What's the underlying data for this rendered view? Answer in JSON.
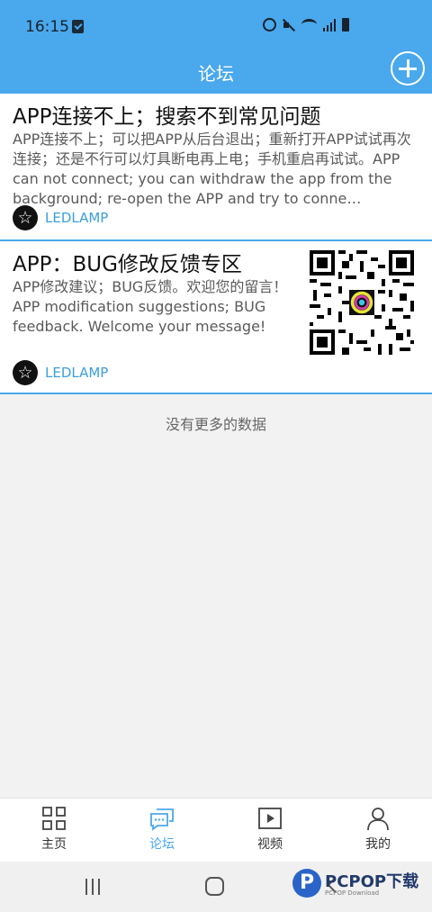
{
  "status_bar": {
    "time": "16:15"
  },
  "header": {
    "title": "论坛"
  },
  "posts": [
    {
      "title": "APP连接不上；搜索不到常见问题",
      "body": "APP连接不上；可以把APP从后台退出；重新打开APP试试再次连接；还是不行可以灯具断电再上电；手机重启再试试。APP can not connect; you can withdraw the app from the background; re-open the APP and try to conne…",
      "author": "LEDLAMP"
    },
    {
      "title": "APP：BUG修改反馈专区",
      "body": "APP修改建议；BUG反馈。欢迎您的留言！APP modification suggestions; BUG feedback.  Welcome your message!",
      "author": "LEDLAMP"
    }
  ],
  "list_footer": "没有更多的数据",
  "tabs": [
    {
      "label": "主页",
      "icon": "grid-icon",
      "active": false
    },
    {
      "label": "论坛",
      "icon": "chat-icon",
      "active": true
    },
    {
      "label": "视频",
      "icon": "play-icon",
      "active": false
    },
    {
      "label": "我的",
      "icon": "person-icon",
      "active": false
    }
  ],
  "watermark": {
    "brand": "PCPOP下载",
    "sub": "PCPOP Download"
  },
  "colors": {
    "accent": "#4aa8ec",
    "author": "#3b9fdc"
  }
}
